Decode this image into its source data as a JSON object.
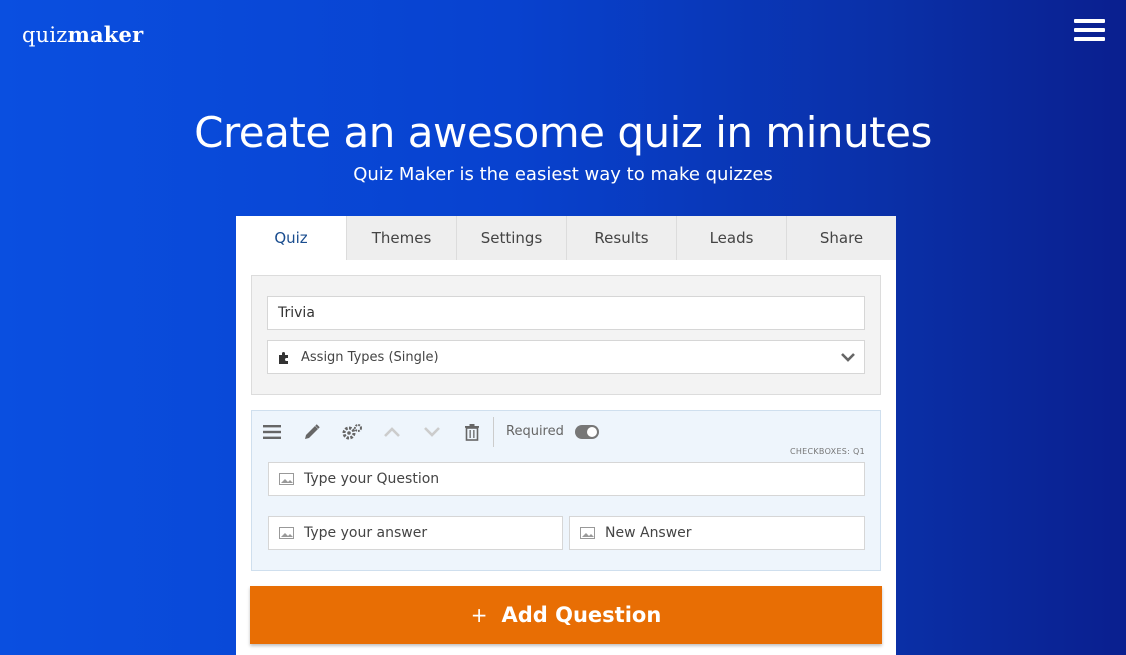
{
  "header": {
    "logo_light": "quiz",
    "logo_bold": "maker",
    "menu_icon": "hamburger-icon"
  },
  "hero": {
    "title": "Create an awesome quiz in minutes",
    "subtitle": "Quiz Maker is the easiest way to make quizzes"
  },
  "tabs": [
    "Quiz",
    "Themes",
    "Settings",
    "Results",
    "Leads",
    "Share"
  ],
  "active_tab": "Quiz",
  "quiz": {
    "title_value": "Trivia",
    "assign_types": "Assign Types (Single)"
  },
  "question": {
    "required_label": "Required",
    "type_label": "CHECKBOXES: Q1",
    "question_placeholder": "Type your Question",
    "answers": [
      "Type your answer",
      "New Answer"
    ]
  },
  "add_button": {
    "icon": "+",
    "label": "Add Question"
  },
  "colors": {
    "accent_orange": "#e86e04",
    "background_blue": "#0842cf",
    "active_tab_text": "#1a4d8f"
  }
}
